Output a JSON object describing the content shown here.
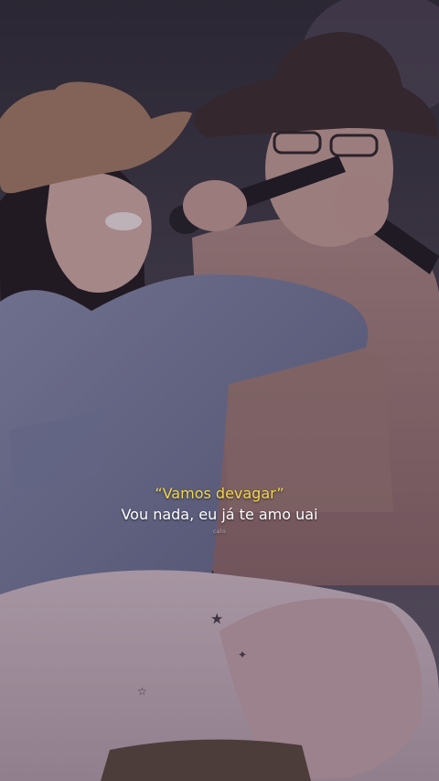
{
  "captions": {
    "highlight": "“Vamos devagar”",
    "main": "Vou nada, eu já te amo uai",
    "watermark": "calo"
  },
  "colors": {
    "highlight_text": "#f2d64b",
    "main_text": "#ffffff"
  }
}
